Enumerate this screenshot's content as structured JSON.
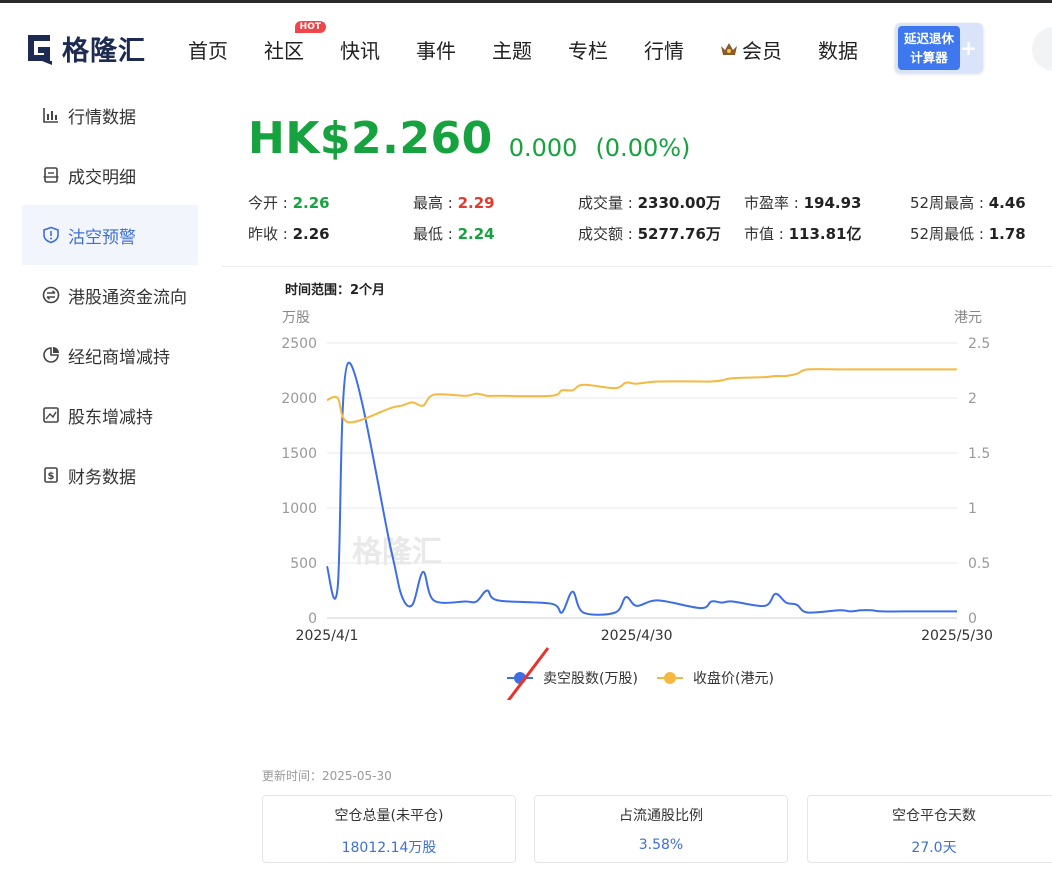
{
  "header": {
    "logo_text": "格隆汇",
    "nav": [
      {
        "label": "首页"
      },
      {
        "label": "社区",
        "badge": "HOT"
      },
      {
        "label": "快讯"
      },
      {
        "label": "事件"
      },
      {
        "label": "主题"
      },
      {
        "label": "专栏"
      },
      {
        "label": "行情"
      },
      {
        "label": "会员",
        "icon": "crown-icon"
      },
      {
        "label": "数据"
      }
    ],
    "calc_button": {
      "line1": "延迟退休",
      "line2": "计算器",
      "plus": "+"
    }
  },
  "sidebar": {
    "items": [
      {
        "label": "行情数据",
        "icon": "bar-chart-icon"
      },
      {
        "label": "成交明细",
        "icon": "receipt-icon"
      },
      {
        "label": "沽空预警",
        "icon": "shield-icon",
        "active": true
      },
      {
        "label": "港股通资金流向",
        "icon": "exchange-icon"
      },
      {
        "label": "经纪商增减持",
        "icon": "pie-chart-icon"
      },
      {
        "label": "股东增减持",
        "icon": "image-chart-icon"
      },
      {
        "label": "财务数据",
        "icon": "finance-doc-icon"
      }
    ]
  },
  "quote": {
    "price": "HK$2.260",
    "change": "0.000",
    "change_pct": "(0.00%)",
    "stats": {
      "open_label": "今开 : ",
      "open": "2.26",
      "prev_close_label": "昨收 : ",
      "prev_close": "2.26",
      "high_label": "最高 : ",
      "high": "2.29",
      "low_label": "最低 : ",
      "low": "2.24",
      "volume_label": "成交量 : ",
      "volume": "2330.00万",
      "turnover_label": "成交额 : ",
      "turnover": "5277.76万",
      "pe_label": "市盈率 : ",
      "pe": "194.93",
      "mcap_label": "市值 : ",
      "mcap": "113.81亿",
      "wk52_high_label": "52周最高 : ",
      "wk52_high": "4.46",
      "wk52_low_label": "52周最低 : ",
      "wk52_low": "1.78"
    }
  },
  "range": {
    "label": "时间范围：",
    "value": "2个月"
  },
  "chart_data": {
    "type": "line",
    "left_axis_unit": "万股",
    "right_axis_unit": "港元",
    "y_left_ticks": [
      "2500",
      "2000",
      "1500",
      "1000",
      "500",
      "0"
    ],
    "y_right_ticks": [
      "2.5",
      "2",
      "1.5",
      "1",
      "0.5",
      "0"
    ],
    "ylim_left": [
      0,
      2500
    ],
    "ylim_right": [
      0,
      2.5
    ],
    "x_tick_labels": [
      "2025/4/1",
      "2025/4/30",
      "2025/5/30"
    ],
    "x": [
      "2025-04-01",
      "2025-04-02",
      "2025-04-03",
      "2025-04-07",
      "2025-04-08",
      "2025-04-09",
      "2025-04-10",
      "2025-04-11",
      "2025-04-14",
      "2025-04-15",
      "2025-04-16",
      "2025-04-17",
      "2025-04-22",
      "2025-04-23",
      "2025-04-24",
      "2025-04-25",
      "2025-04-28",
      "2025-04-29",
      "2025-04-30",
      "2025-05-02",
      "2025-05-06",
      "2025-05-07",
      "2025-05-08",
      "2025-05-09",
      "2025-05-12",
      "2025-05-13",
      "2025-05-14",
      "2025-05-15",
      "2025-05-16",
      "2025-05-19",
      "2025-05-20",
      "2025-05-21",
      "2025-05-22",
      "2025-05-23",
      "2025-05-26",
      "2025-05-27",
      "2025-05-28",
      "2025-05-29",
      "2025-05-30"
    ],
    "series": [
      {
        "name": "卖空股数(万股)",
        "axis": "left",
        "color": "#3d6ee6",
        "values": [
          470,
          280,
          2320,
          620,
          200,
          120,
          420,
          160,
          150,
          150,
          250,
          160,
          130,
          50,
          240,
          50,
          50,
          190,
          110,
          160,
          90,
          150,
          140,
          150,
          110,
          220,
          140,
          120,
          50,
          70,
          60,
          70,
          70,
          60,
          60,
          60,
          60,
          60,
          60
        ]
      },
      {
        "name": "收盘价(港元)",
        "axis": "right",
        "color": "#f5b942",
        "values": [
          1.98,
          2.0,
          1.78,
          1.91,
          1.93,
          1.96,
          1.93,
          2.03,
          2.02,
          2.04,
          2.02,
          2.02,
          2.02,
          2.07,
          2.07,
          2.12,
          2.09,
          2.14,
          2.13,
          2.15,
          2.15,
          2.15,
          2.16,
          2.18,
          2.19,
          2.2,
          2.2,
          2.22,
          2.26,
          2.26,
          2.26,
          2.26,
          2.26,
          2.26,
          2.26,
          2.26,
          2.26,
          2.26,
          2.26
        ]
      }
    ],
    "legend_position": "bottom",
    "grid": true,
    "watermark": "格隆汇"
  },
  "footer": {
    "update_label": "更新时间：",
    "update_date": "2025-05-30",
    "cards": [
      {
        "title": "空仓总量(未平仓)",
        "value": "18012.14万股"
      },
      {
        "title": "占流通股比例",
        "value": "3.58%"
      },
      {
        "title": "空仓平仓天数",
        "value": "27.0天"
      }
    ]
  },
  "colors": {
    "green": "#16a23f",
    "red": "#e23b2e",
    "accent": "#3e6fd8",
    "arrow": "#e8322b"
  }
}
